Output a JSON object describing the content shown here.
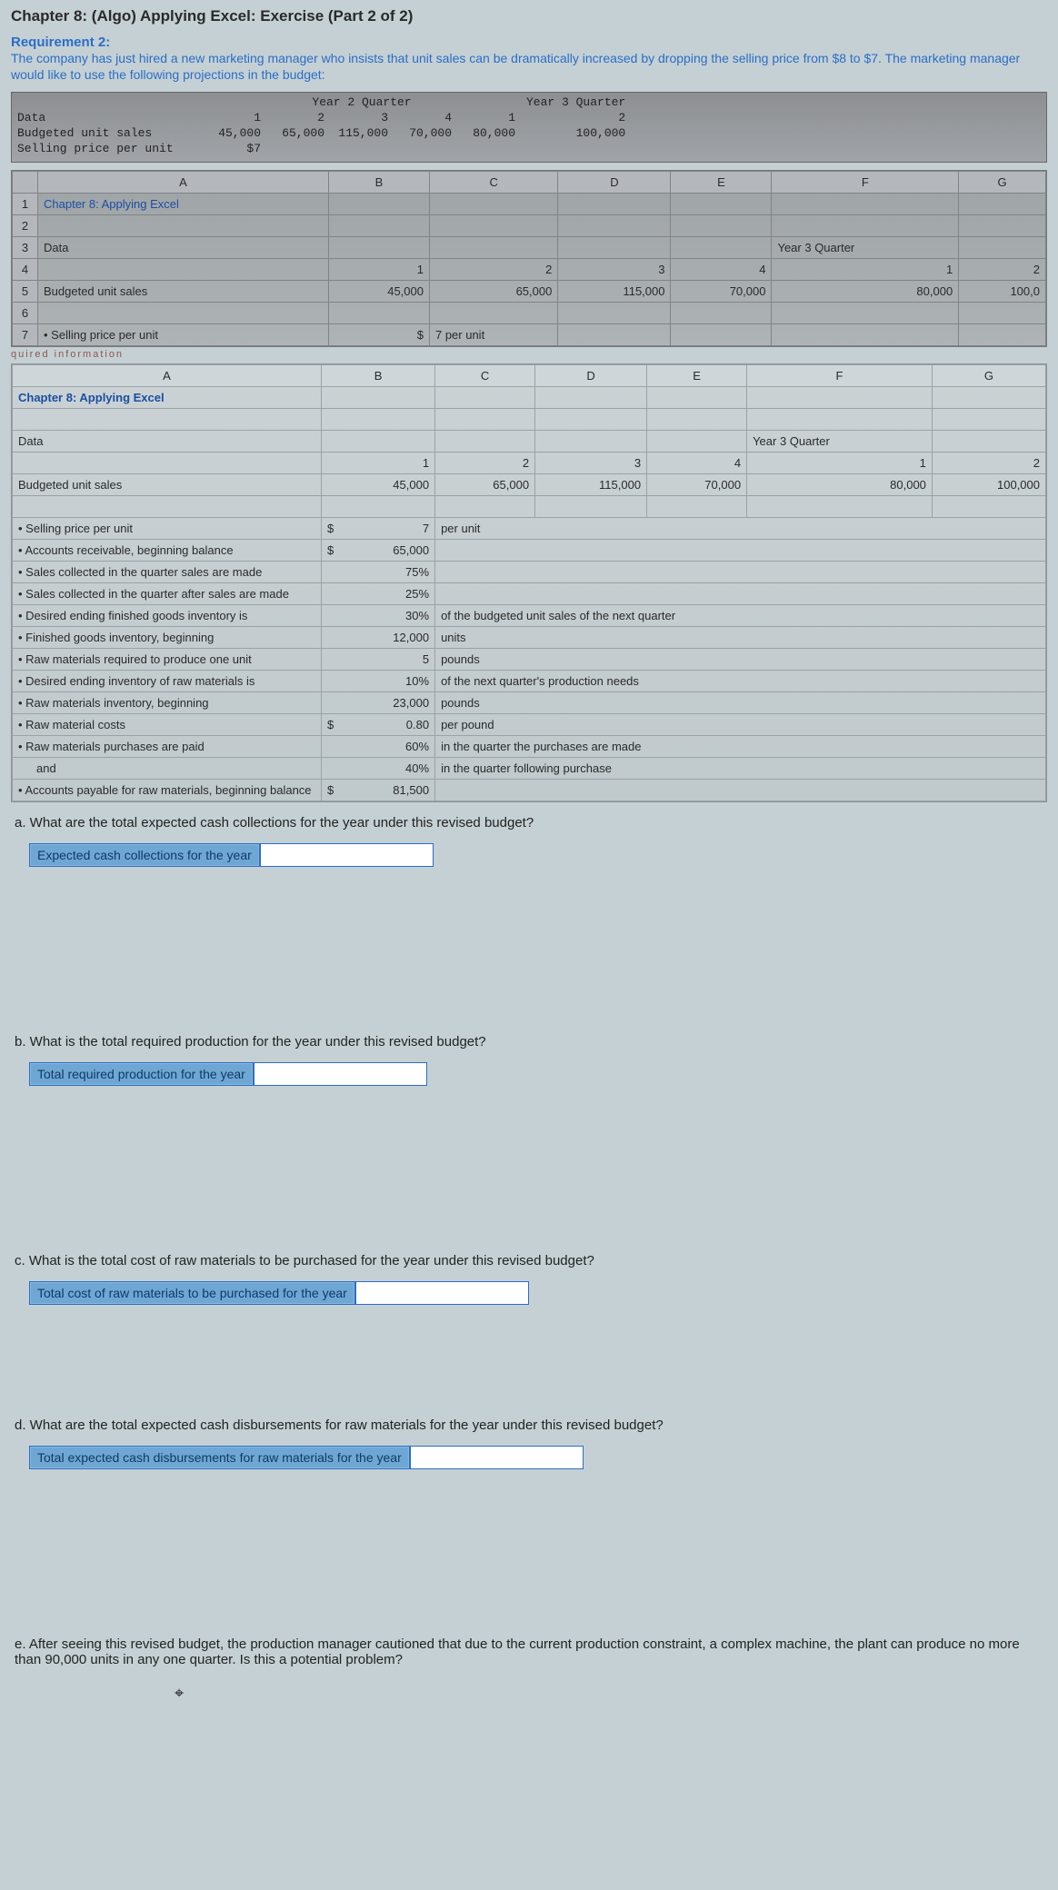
{
  "header": {
    "title": "Chapter 8: (Algo) Applying Excel: Exercise (Part 2 of 2)",
    "reqTitle": "Requirement 2:",
    "reqDesc": "The company has just hired a new marketing manager who insists that unit sales can be dramatically increased by dropping the selling price from $8 to $7. The marketing manager would like to use the following projections in the budget:"
  },
  "dataStrip": {
    "group1": "Year 2 Quarter",
    "group2": "Year 3 Quarter",
    "cols": [
      "1",
      "2",
      "3",
      "4",
      "1",
      "2"
    ],
    "rows": [
      {
        "label": "Data",
        "vals": [
          "",
          "",
          "",
          "",
          "",
          ""
        ]
      },
      {
        "label": "Budgeted unit sales",
        "vals": [
          "45,000",
          "65,000",
          "115,000",
          "70,000",
          "80,000",
          "100,000"
        ]
      },
      {
        "label": "Selling price per unit",
        "vals": [
          "$7",
          "",
          "",
          "",
          "",
          ""
        ]
      }
    ]
  },
  "excel1": {
    "cols": [
      "A",
      "B",
      "C",
      "D",
      "E",
      "F",
      "G"
    ],
    "rows": [
      {
        "n": "1",
        "a": "Chapter 8: Applying Excel",
        "link": true
      },
      {
        "n": "2",
        "a": ""
      },
      {
        "n": "3",
        "a": "Data",
        "fLabel": "Year 3 Quarter"
      },
      {
        "n": "4",
        "a": "",
        "b": "1",
        "c": "2",
        "d": "3",
        "e": "4",
        "f": "1",
        "g": "2"
      },
      {
        "n": "5",
        "a": "Budgeted unit sales",
        "b": "45,000",
        "c": "65,000",
        "d": "115,000",
        "e": "70,000",
        "f": "80,000",
        "g": "100,0"
      },
      {
        "n": "6",
        "a": ""
      },
      {
        "n": "7",
        "a": "• Selling price per unit",
        "b": "$",
        "c": "7 per unit"
      }
    ],
    "partial": "quired information"
  },
  "excel2": {
    "cols": [
      "A",
      "B",
      "C",
      "D",
      "E",
      "F",
      "G"
    ],
    "title": "Chapter 8: Applying Excel",
    "dataLabel": "Data",
    "fLabel": "Year 3 Quarter",
    "numHeaders": [
      "1",
      "2",
      "3",
      "4",
      "1",
      "2"
    ],
    "budgeted": {
      "label": "Budgeted unit sales",
      "vals": [
        "45,000",
        "65,000",
        "115,000",
        "70,000",
        "80,000",
        "100,000"
      ]
    },
    "items": [
      {
        "label": "Selling price per unit",
        "b": "$",
        "bnum": "7",
        "note": "per unit"
      },
      {
        "label": "Accounts receivable, beginning balance",
        "b": "$",
        "bnum": "65,000"
      },
      {
        "label": "Sales collected in the quarter sales are made",
        "bnum": "75%"
      },
      {
        "label": "Sales collected in the quarter after sales are made",
        "bnum": "25%"
      },
      {
        "label": "Desired ending finished goods inventory is",
        "bnum": "30%",
        "note": "of the budgeted unit sales of the next quarter"
      },
      {
        "label": "Finished goods inventory, beginning",
        "bnum": "12,000",
        "note": "units"
      },
      {
        "label": "Raw materials required to produce one unit",
        "bnum": "5",
        "note": "pounds"
      },
      {
        "label": "Desired ending inventory of raw materials is",
        "bnum": "10%",
        "note": "of the next quarter's production needs"
      },
      {
        "label": "Raw materials inventory, beginning",
        "bnum": "23,000",
        "note": "pounds"
      },
      {
        "label": "Raw material costs",
        "b": "$",
        "bnum": "0.80",
        "note": "per pound"
      },
      {
        "label": "Raw materials purchases are paid",
        "bnum": "60%",
        "note": "in the quarter the purchases are made"
      },
      {
        "label": "and",
        "indent": true,
        "bnum": "40%",
        "note": "in the quarter following purchase"
      },
      {
        "label": "Accounts payable for raw materials, beginning balance",
        "b": "$",
        "bnum": "81,500"
      }
    ]
  },
  "questions": {
    "a": {
      "text": "a. What are the total expected cash collections for the year under this revised budget?",
      "label": "Expected cash collections for the year"
    },
    "b": {
      "text": "b. What is the total required production for the year under this revised budget?",
      "label": "Total required production for the year"
    },
    "c": {
      "text": "c. What is the total cost of raw materials to be purchased for the year under this revised budget?",
      "label": "Total cost of raw materials to be purchased for the year"
    },
    "d": {
      "text": "d. What are the total expected cash disbursements for raw materials for the year under this revised budget?",
      "label": "Total expected cash disbursements for raw materials for the year"
    },
    "e": {
      "text": "e. After seeing this revised budget, the production manager cautioned that due to the current production constraint, a complex machine, the plant can produce no more than 90,000 units in any one quarter. Is this a potential problem?"
    }
  }
}
